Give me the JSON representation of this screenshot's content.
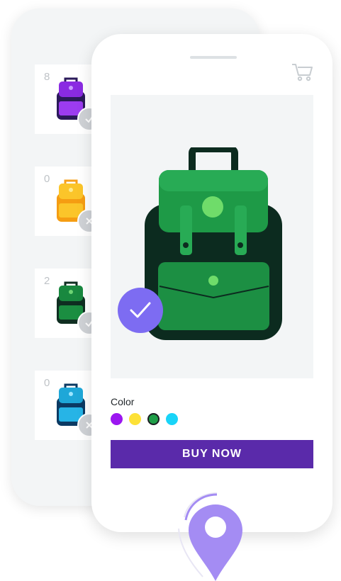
{
  "inventory": [
    {
      "count": "8",
      "color": "#8a2be2",
      "status": "in-stock"
    },
    {
      "count": "0",
      "color": "#f7b818",
      "status": "out-of-stock"
    },
    {
      "count": "2",
      "color": "#19883f",
      "status": "in-stock"
    },
    {
      "count": "0",
      "color": "#1ea7d8",
      "status": "out-of-stock"
    }
  ],
  "product": {
    "selected_color": "#1f9e48",
    "color_label": "Color",
    "colors": [
      "#9b16f0",
      "#fde137",
      "#1f9e48",
      "#19d4f8"
    ],
    "buy_label": "BUY NOW"
  },
  "icons": {
    "cart": "cart-icon",
    "check": "check-icon",
    "close": "close-icon",
    "location": "location-pin-icon"
  },
  "accent": {
    "buy_button": "#5a2aaa",
    "check_circle": "#7d6cf2",
    "pin": "#a48cf3"
  }
}
